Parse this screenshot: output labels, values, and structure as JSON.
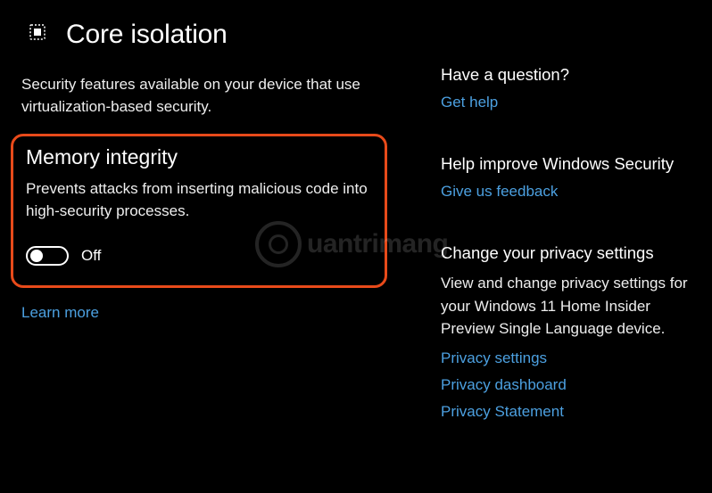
{
  "header": {
    "title": "Core isolation"
  },
  "main": {
    "subtitle": "Security features available on your device that use virtualization-based security.",
    "memory_integrity": {
      "title": "Memory integrity",
      "description": "Prevents attacks from inserting malicious code into high-security processes.",
      "state": "Off"
    },
    "learn_more": "Learn more"
  },
  "sidebar": {
    "question": {
      "heading": "Have a question?",
      "link": "Get help"
    },
    "improve": {
      "heading": "Help improve Windows Security",
      "link": "Give us feedback"
    },
    "privacy": {
      "heading": "Change your privacy settings",
      "body": "View and change privacy settings for your Windows 11 Home Insider Preview Single Language device.",
      "links": [
        "Privacy settings",
        "Privacy dashboard",
        "Privacy Statement"
      ]
    }
  },
  "watermark": {
    "text": "uantrimang"
  }
}
